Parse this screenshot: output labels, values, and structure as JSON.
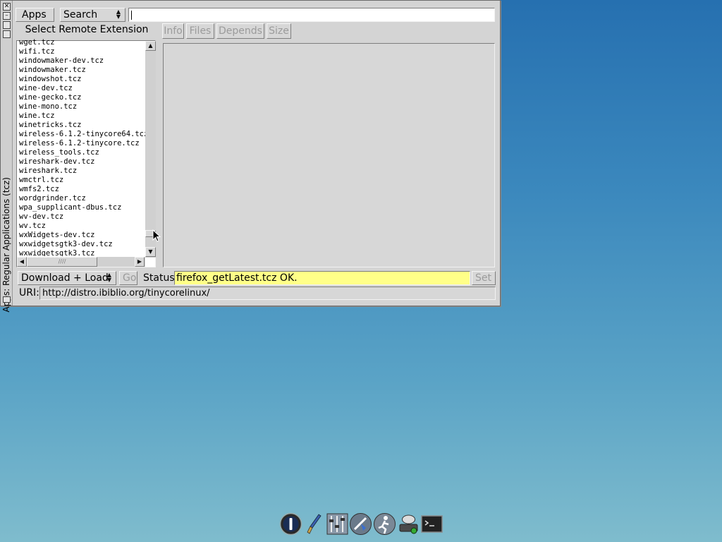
{
  "window": {
    "title": "Apps: Regular Applications (tcz)",
    "controls": {
      "close": "✕",
      "minimize": "–"
    }
  },
  "toolbar": {
    "apps_label": "Apps",
    "search_mode": "Search",
    "search_value": ""
  },
  "list": {
    "heading": "Select Remote Extension",
    "items": [
      "wget.tcz",
      "wifi.tcz",
      "windowmaker-dev.tcz",
      "windowmaker.tcz",
      "windowshot.tcz",
      "wine-dev.tcz",
      "wine-gecko.tcz",
      "wine-mono.tcz",
      "wine.tcz",
      "winetricks.tcz",
      "wireless-6.1.2-tinycore64.tcz",
      "wireless-6.1.2-tinycore.tcz",
      "wireless_tools.tcz",
      "wireshark-dev.tcz",
      "wireshark.tcz",
      "wmctrl.tcz",
      "wmfs2.tcz",
      "wordgrinder.tcz",
      "wpa_supplicant-dbus.tcz",
      "wv-dev.tcz",
      "wv.tcz",
      "wxWidgets-dev.tcz",
      "wxwidgetsgtk3-dev.tcz",
      "wxwidgetsgtk3.tcz"
    ]
  },
  "tabs": [
    "Info",
    "Files",
    "Depends",
    "Size"
  ],
  "bottom": {
    "mode_label": "Download + Load",
    "go_label": "Go",
    "status_label": "Status",
    "status_text": "firefox_getLatest.tcz OK.",
    "set_label": "Set",
    "uri_label": "URI:",
    "uri_value": "http://distro.ibiblio.org/tinycorelinux/"
  },
  "dock": {
    "icons": [
      "power-icon",
      "paintbrush-icon",
      "control-panel-icon",
      "apps-icon",
      "run-icon",
      "mount-tool-icon",
      "terminal-icon"
    ]
  },
  "colors": {
    "status_bg": "#ffff88",
    "desktop_top": "#2670b0",
    "desktop_bottom": "#7fbccd"
  }
}
